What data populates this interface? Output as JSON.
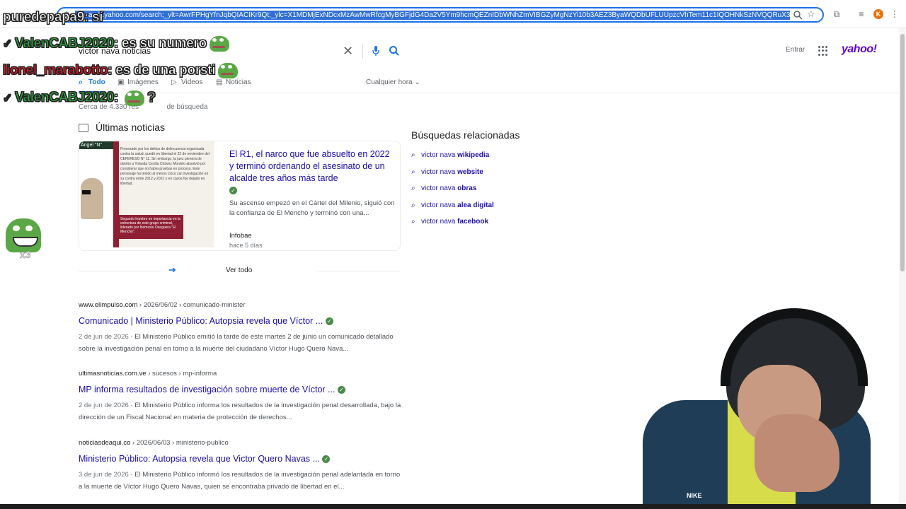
{
  "browser": {
    "url": "...search.yahoo.com/search;_ylt=AwrFPHgYfnJqbQIACIKr9Qt;_ylc=X1MDMjExNDcxMzAwMwRfcgMyBGFjdG4Da2V5Ym9hcmQEZnIDbWNhZmVIBGZyMgNzYi10b3AEZ3ByaWQDbUFLUUpzcVhTem11c1IQOHNkSzNVQQRuX3JzbHQDMARuX3N1Z2d",
    "profile_initial": "K"
  },
  "search": {
    "query": "victor nava noticias",
    "sign_in": "Entrar",
    "brand": "yahoo!"
  },
  "tabs": [
    {
      "label": "Todo",
      "icon": "search-icon",
      "active": true
    },
    {
      "label": "Imágenes",
      "icon": "image-icon"
    },
    {
      "label": "Videos",
      "icon": "play-icon"
    },
    {
      "label": "Noticias",
      "icon": "news-icon"
    }
  ],
  "time_filter": "Cualquier hora",
  "result_count": "Cerca de 4.330 res",
  "result_count_tail": "de búsqueda",
  "news": {
    "section_title": "Últimas noticias",
    "title": "El R1, el narco que fue absuelto en 2022 y terminó ordenando el asesinato de un alcalde tres años más tarde",
    "snippet": "Su ascenso empezó en el Cártel del Milenio, siguió con la confianza de El Mencho y terminó con una...",
    "source": "Infobae",
    "time": "hace 5 días",
    "thumb_label": "Ángel \"N\"",
    "thumb_text": "Procesado por los delitos de delincuencia organizada contra la salud, quedó en libertad el 22 de noviembre del CEFERESO N° 11. Sin embargo, la juez primera de distrito a Yolanda Cecilia Chávez Montelo absolvió por considerar que no había pruebas en proceso. Este personaje ha tenido al menos cinco car investigación en su contra entre 2012 y 2021 y en casos fue dejado en libertad.",
    "thumb_red": "Segundo hombre en importancia en la estructura de este grupo criminal, liderado por Nemesio Oseguera \"El Mencho\".",
    "view_all": "Ver todo"
  },
  "results": [
    {
      "host": "www.elimpulso.com",
      "path": " › 2026/06/02 › comunicado-minister",
      "title": "Comunicado | Ministerio Público: Autopsia revela que Víctor ...",
      "date": "2 de jun de 2026",
      "snippet": " · El Ministerio Público emitió la tarde de este martes 2 de junio un comunicado detallado sobre la investigación penal en torno a la muerte del ciudadano Víctor Hugo Quero Nava..."
    },
    {
      "host": "ultimasnoticias.com.ve",
      "path": " › sucesos › mp-informa",
      "title": "MP informa resultados de investigación sobre muerte de Víctor ...",
      "date": "2 de jun de 2026",
      "snippet": " · El Ministerio Público informa los resultados de la investigación penal desarrollada, bajo la dirección de un Fiscal Nacional en materia de protección de derechos..."
    },
    {
      "host": "noticiasdeaqui.co",
      "path": " › 2026/06/03 › ministerio-publico",
      "title": "Ministerio Público: Autopsia revela que Victor Quero Navas ...",
      "date": "3 de jun de 2026",
      "snippet": " · El Ministerio Público informó los resultados de la investigación penal adelantada en torno a la muerte de Víctor Hugo Quero Navas, quien se encontraba privado de libertad en el..."
    }
  ],
  "related": {
    "title": "Búsquedas relacionadas",
    "items": [
      {
        "prefix": "victor nava ",
        "bold": "wikipedia"
      },
      {
        "prefix": "victor nava ",
        "bold": "website"
      },
      {
        "prefix": "victor nava ",
        "bold": "obras"
      },
      {
        "prefix": "victor nava ",
        "bold": "alea digital"
      },
      {
        "prefix": "victor nava ",
        "bold": "facebook"
      }
    ]
  },
  "chat": {
    "watermark": "puredepapa9: sí",
    "lines": [
      {
        "user": "ValenCABJ2020",
        "message": "es su numero"
      },
      {
        "user": "lionel_marabotto",
        "message": "es de una porsti"
      },
      {
        "user": "ValenCABJ2020",
        "message": "?"
      }
    ],
    "emote_count": "x3"
  },
  "webcam": {
    "jacket_logo": "NIKE"
  },
  "colors": {
    "link": "#1a0dab",
    "accent": "#1a73e8",
    "yahoo": "#5f01d1",
    "chat_green": "#2e9e3e",
    "chat_red": "#d11b2a"
  }
}
